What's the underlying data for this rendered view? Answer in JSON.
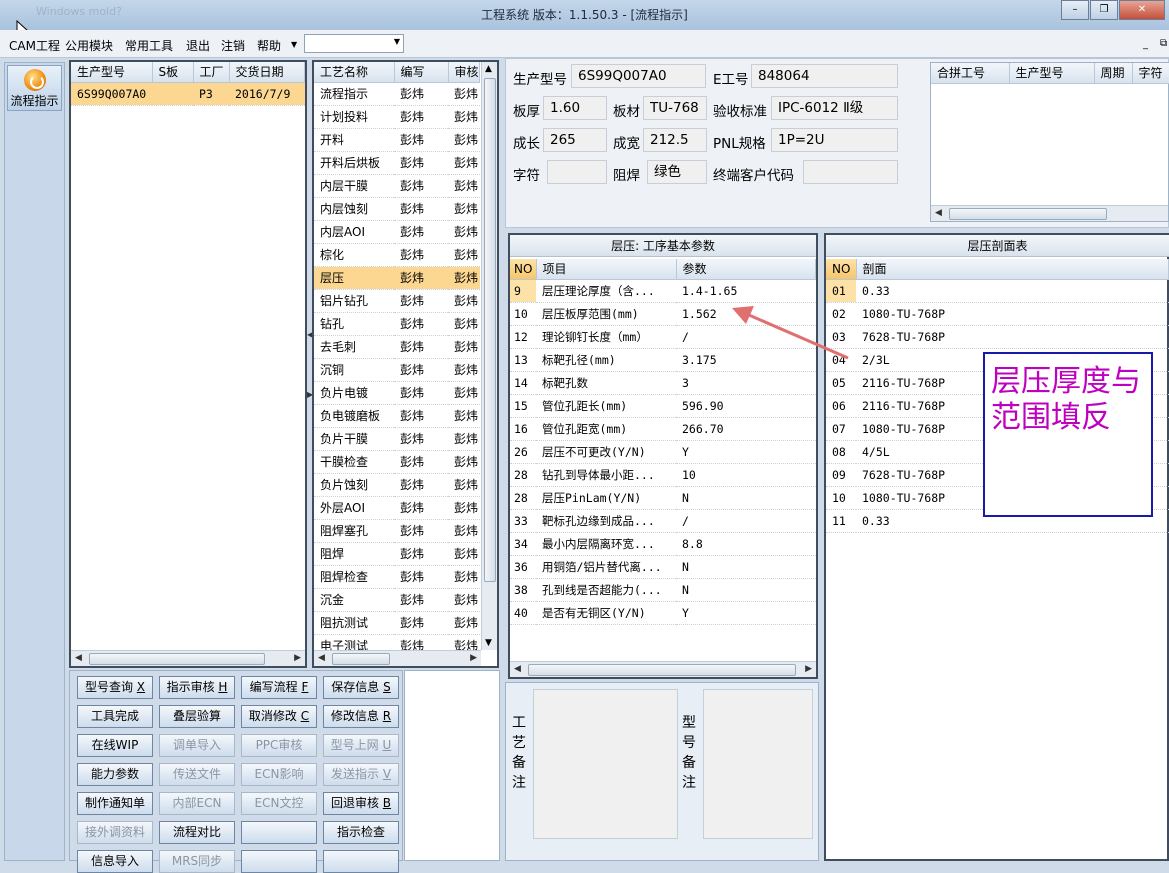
{
  "window": {
    "title": "工程系统    版本：1.1.50.3 - [流程指示]",
    "ghost_title": "Windows mold?"
  },
  "menu": {
    "items": [
      "CAM工程",
      "公用模块",
      "常用工具",
      "退出",
      "注销",
      "帮助"
    ],
    "combo_value": ""
  },
  "nav": {
    "flow_button": "流程指示"
  },
  "orders": {
    "headers": [
      "生产型号",
      "S板",
      "工厂",
      "交货日期"
    ],
    "rows": [
      [
        "6S99Q007A0",
        "",
        "P3",
        "2016/7/9"
      ]
    ]
  },
  "process": {
    "headers": [
      "工艺名称",
      "编写",
      "审核"
    ],
    "rows": [
      [
        "流程指示",
        "彭炜",
        "彭炜"
      ],
      [
        "计划投料",
        "彭炜",
        "彭炜"
      ],
      [
        "开料",
        "彭炜",
        "彭炜"
      ],
      [
        "开料后烘板",
        "彭炜",
        "彭炜"
      ],
      [
        "内层干膜",
        "彭炜",
        "彭炜"
      ],
      [
        "内层蚀刻",
        "彭炜",
        "彭炜"
      ],
      [
        "内层AOI",
        "彭炜",
        "彭炜"
      ],
      [
        "棕化",
        "彭炜",
        "彭炜"
      ],
      [
        "层压",
        "彭炜",
        "彭炜"
      ],
      [
        "铝片钻孔",
        "彭炜",
        "彭炜"
      ],
      [
        "钻孔",
        "彭炜",
        "彭炜"
      ],
      [
        "去毛刺",
        "彭炜",
        "彭炜"
      ],
      [
        "沉铜",
        "彭炜",
        "彭炜"
      ],
      [
        "负片电镀",
        "彭炜",
        "彭炜"
      ],
      [
        "负电镀磨板",
        "彭炜",
        "彭炜"
      ],
      [
        "负片干膜",
        "彭炜",
        "彭炜"
      ],
      [
        "干膜检查",
        "彭炜",
        "彭炜"
      ],
      [
        "负片蚀刻",
        "彭炜",
        "彭炜"
      ],
      [
        "外层AOI",
        "彭炜",
        "彭炜"
      ],
      [
        "阻焊塞孔",
        "彭炜",
        "彭炜"
      ],
      [
        "阻焊",
        "彭炜",
        "彭炜"
      ],
      [
        "阻焊检查",
        "彭炜",
        "彭炜"
      ],
      [
        "沉金",
        "彭炜",
        "彭炜"
      ],
      [
        "阻抗测试",
        "彭炜",
        "彭炜"
      ],
      [
        "电子测试",
        "彭炜",
        "彭炜"
      ]
    ],
    "selected_index": 8
  },
  "buttons": [
    {
      "label": "型号查询",
      "key": "X",
      "enabled": true
    },
    {
      "label": "指示审核",
      "key": "H",
      "enabled": true
    },
    {
      "label": "编写流程",
      "key": "F",
      "enabled": true
    },
    {
      "label": "保存信息",
      "key": "S",
      "enabled": true
    },
    {
      "label": "工具完成",
      "key": "",
      "enabled": true
    },
    {
      "label": "叠层验算",
      "key": "",
      "enabled": true
    },
    {
      "label": "取消修改",
      "key": "C",
      "enabled": true
    },
    {
      "label": "修改信息",
      "key": "R",
      "enabled": true
    },
    {
      "label": "在线WIP",
      "key": "",
      "enabled": true
    },
    {
      "label": "调单导入",
      "key": "",
      "enabled": false
    },
    {
      "label": "PPC审核",
      "key": "",
      "enabled": false
    },
    {
      "label": "型号上网",
      "key": "U",
      "enabled": false
    },
    {
      "label": "能力参数",
      "key": "",
      "enabled": true
    },
    {
      "label": "传送文件",
      "key": "",
      "enabled": false
    },
    {
      "label": "ECN影响",
      "key": "",
      "enabled": false
    },
    {
      "label": "发送指示",
      "key": "V",
      "enabled": false
    },
    {
      "label": "制作通知单",
      "key": "",
      "enabled": true
    },
    {
      "label": "内部ECN",
      "key": "",
      "enabled": false
    },
    {
      "label": "ECN文控",
      "key": "",
      "enabled": false
    },
    {
      "label": "回退审核",
      "key": "B",
      "enabled": true
    },
    {
      "label": "接外调资料",
      "key": "",
      "enabled": false
    },
    {
      "label": "流程对比",
      "key": "",
      "enabled": true
    },
    {
      "label": "",
      "key": "",
      "enabled": true
    },
    {
      "label": "指示检查",
      "key": "",
      "enabled": true
    },
    {
      "label": "信息导入",
      "key": "",
      "enabled": true
    },
    {
      "label": "MRS同步",
      "key": "",
      "enabled": false
    },
    {
      "label": "",
      "key": "",
      "enabled": true
    },
    {
      "label": "",
      "key": "",
      "enabled": true
    }
  ],
  "info": {
    "model_label": "生产型号",
    "model": "6S99Q007A0",
    "e_label": "E工号",
    "e_no": "848064",
    "thick_label": "板厚",
    "thick": "1.60",
    "mat_label": "板材",
    "mat": "TU-768",
    "std_label": "验收标准",
    "std": "IPC-6012 Ⅱ级",
    "len_label": "成长",
    "len": "265",
    "wid_label": "成宽",
    "wid": "212.5",
    "pnl_label": "PNL规格",
    "pnl": "1P=2U",
    "char_label": "字符",
    "char": "",
    "mask_label": "阻焊",
    "mask": "绿色",
    "cust_label": "终端客户代码",
    "cust": ""
  },
  "merge": {
    "headers": [
      "合拼工号",
      "生产型号",
      "周期",
      "字符"
    ]
  },
  "params": {
    "title": "层压: 工序基本参数",
    "headers": [
      "NO",
      "项目",
      "参数"
    ],
    "rows": [
      [
        "9",
        "层压理论厚度（含...",
        "1.4-1.65"
      ],
      [
        "10",
        "层压板厚范围(mm)",
        "1.562"
      ],
      [
        "12",
        "理论铆钉长度（mm）",
        "/"
      ],
      [
        "13",
        "标靶孔径(mm)",
        "3.175"
      ],
      [
        "14",
        "标靶孔数",
        "3"
      ],
      [
        "15",
        "管位孔距长(mm)",
        "596.90"
      ],
      [
        "16",
        "管位孔距宽(mm)",
        "266.70"
      ],
      [
        "26",
        "层压不可更改(Y/N)",
        "Y"
      ],
      [
        "28",
        "钻孔到导体最小距...",
        "10"
      ],
      [
        "28",
        "层压PinLam(Y/N)",
        "N"
      ],
      [
        "33",
        "靶标孔边缘到成品...",
        "/"
      ],
      [
        "34",
        "最小内层隔离环宽...",
        "8.8"
      ],
      [
        "36",
        "用铜箔/铝片替代离...",
        "N"
      ],
      [
        "38",
        "孔到线是否超能力(...",
        "N"
      ],
      [
        "40",
        "是否有无铜区(Y/N)",
        "Y"
      ]
    ]
  },
  "stack": {
    "title": "层压剖面表",
    "headers": [
      "NO",
      "剖面"
    ],
    "rows": [
      [
        "01",
        "0.33"
      ],
      [
        "02",
        "1080-TU-768P"
      ],
      [
        "03",
        "7628-TU-768P"
      ],
      [
        "04",
        "2/3L"
      ],
      [
        "05",
        "2116-TU-768P"
      ],
      [
        "06",
        "2116-TU-768P"
      ],
      [
        "07",
        "1080-TU-768P"
      ],
      [
        "08",
        "4/5L"
      ],
      [
        "09",
        "7628-TU-768P"
      ],
      [
        "10",
        "1080-TU-768P"
      ],
      [
        "11",
        "0.33"
      ]
    ]
  },
  "notes": {
    "craft_label": "工艺备注",
    "model_label": "型号备注"
  },
  "annotation": {
    "text": "层压厚度与范围填反",
    "color": "#c000c0",
    "border": "#1a1aa8",
    "arrow": "#e07070"
  }
}
